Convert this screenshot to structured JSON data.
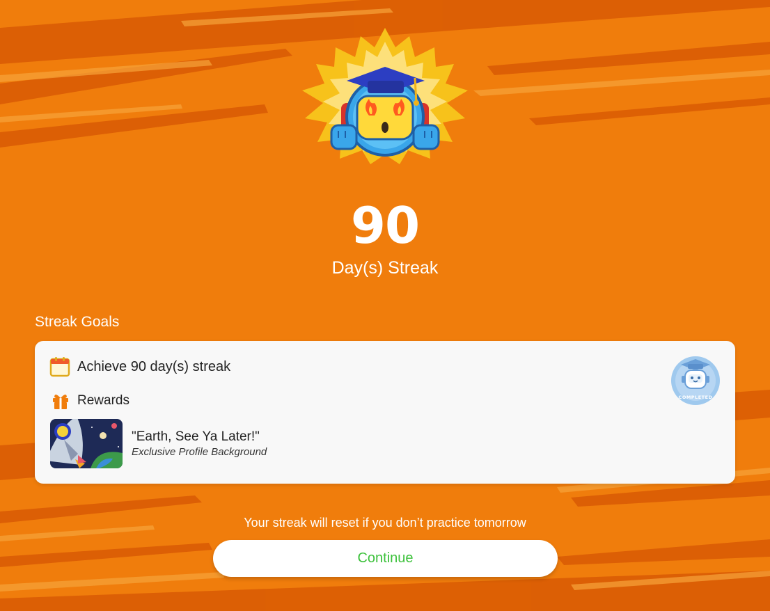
{
  "theme": {
    "background": "#f07d0c",
    "streak_dark": "#d95a04",
    "streak_light": "#f59a2c",
    "card": "#f8f8f8",
    "accent_green": "#3cc13b"
  },
  "mascot": {
    "icon": "graduate-robot-flame-icon"
  },
  "streak": {
    "count": "90",
    "unit_label": "Day(s) Streak"
  },
  "goals": {
    "section_title": "Streak Goals",
    "goal_icon": "calendar-icon",
    "goal_text": "Achieve 90 day(s) streak",
    "rewards_icon": "gift-icon",
    "rewards_label": "Rewards",
    "reward": {
      "thumbnail_icon": "rocket-space-thumbnail",
      "name": "\"Earth, See Ya Later!\"",
      "type": "Exclusive Profile Background"
    },
    "badge": {
      "icon": "completed-robot-badge-icon",
      "text": "COMPLETED"
    }
  },
  "footer": {
    "warning": "Your streak will reset if you don’t practice tomorrow",
    "continue_label": "Continue"
  }
}
